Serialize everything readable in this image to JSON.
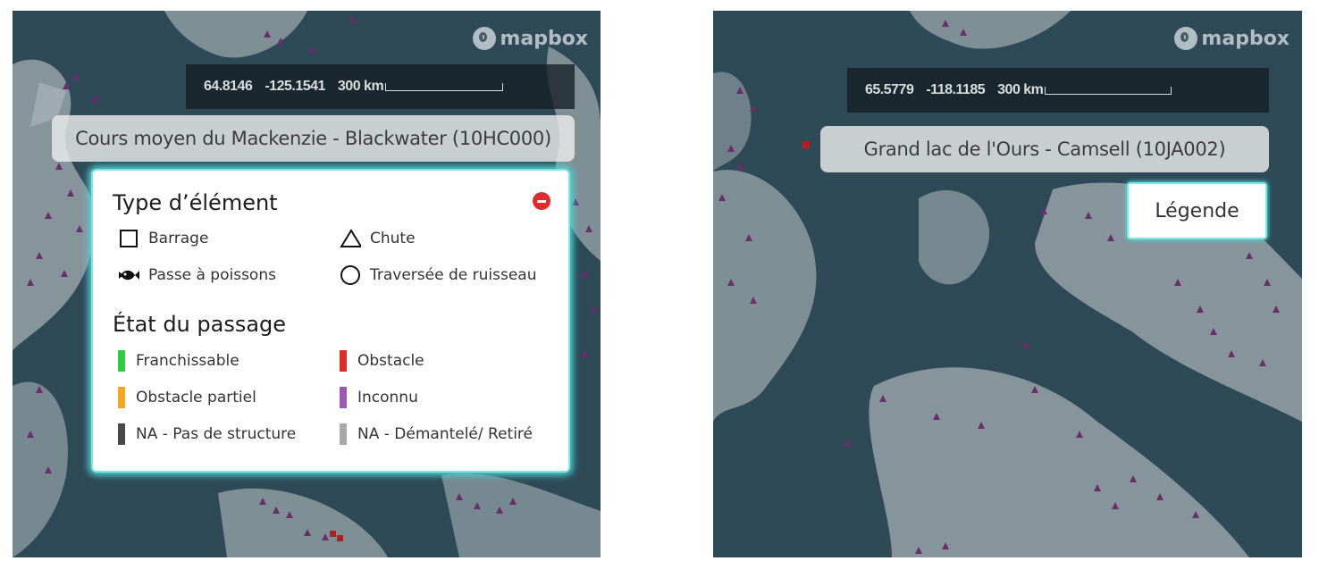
{
  "map_left": {
    "attribution": "mapbox",
    "coords": {
      "lat": "64.8146",
      "lng": "-125.1541",
      "scale": "300 km"
    },
    "subtitle": "Cours moyen du Mackenzie - Blackwater (10HC000)",
    "legend": {
      "type_title": "Type d’élément",
      "types": [
        {
          "label": "Barrage",
          "icon": "square-outline-icon"
        },
        {
          "label": "Chute",
          "icon": "triangle-outline-icon"
        },
        {
          "label": "Passe à poissons",
          "icon": "fish-icon"
        },
        {
          "label": "Traversée de ruisseau",
          "icon": "circle-outline-icon"
        }
      ],
      "status_title": "État du passage",
      "statuses": [
        {
          "label": "Franchissable",
          "color": "#2ecc40"
        },
        {
          "label": "Obstacle",
          "color": "#e02b2b"
        },
        {
          "label": "Obstacle partiel",
          "color": "#f5a623"
        },
        {
          "label": "Inconnu",
          "color": "#9b59b6"
        },
        {
          "label": "NA - Pas de structure",
          "color": "#4a4a4a"
        },
        {
          "label": "NA - Démantelé/ Retiré",
          "color": "#a8a8a8"
        }
      ],
      "close_icon": "minus-circle-icon"
    }
  },
  "map_right": {
    "attribution": "mapbox",
    "coords": {
      "lat": "65.5779",
      "lng": "-118.1185",
      "scale": "300 km"
    },
    "subtitle": "Grand lac de l'Ours - Camsell (10JA002)",
    "legend_button": "Légende"
  },
  "colors": {
    "water": "#2e4a57",
    "land": "#cfd4d6",
    "marker_unknown": "#6b2e6b",
    "marker_obstacle": "#b81c1c",
    "legend_glow": "#4dd8d8"
  }
}
